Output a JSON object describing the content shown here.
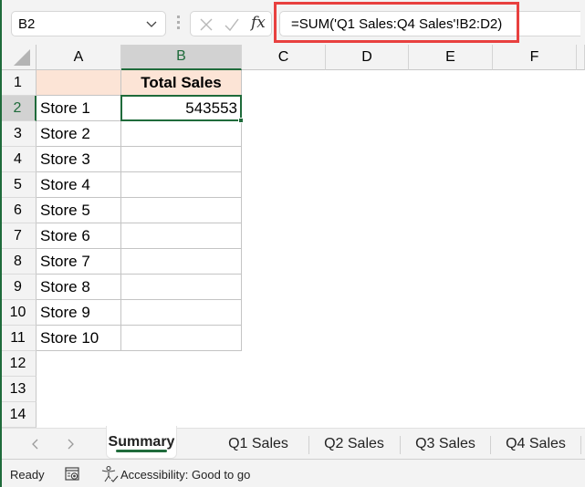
{
  "formula_bar": {
    "name_box": "B2",
    "cancel_icon": "x-icon",
    "enter_icon": "check-icon",
    "fx_label": "fx",
    "formula": "=SUM('Q1 Sales:Q4 Sales'!B2:D2)",
    "highlight_color": "#e8403f"
  },
  "columns": [
    "A",
    "B",
    "C",
    "D",
    "E",
    "F"
  ],
  "selected_column": "B",
  "rows": [
    "1",
    "2",
    "3",
    "4",
    "5",
    "6",
    "7",
    "8",
    "9",
    "10",
    "11",
    "12",
    "13",
    "14"
  ],
  "selected_row": "2",
  "cells": {
    "A": [
      "",
      "Store 1",
      "Store 2",
      "Store 3",
      "Store 4",
      "Store 5",
      "Store 6",
      "Store 7",
      "Store 8",
      "Store 9",
      "Store 10"
    ],
    "B": [
      "Total Sales",
      "543553",
      "",
      "",
      "",
      "",
      "",
      "",
      "",
      "",
      ""
    ]
  },
  "header_fill_color": "#fce4d6",
  "accent_color": "#1f6b3b",
  "sheet_tabs": {
    "prev_icon": "chevron-left-icon",
    "next_icon": "chevron-right-icon",
    "tabs": [
      {
        "label": "Summary",
        "active": true
      },
      {
        "label": "Q1 Sales",
        "active": false
      },
      {
        "label": "Q2 Sales",
        "active": false
      },
      {
        "label": "Q3 Sales",
        "active": false
      },
      {
        "label": "Q4 Sales",
        "active": false
      }
    ]
  },
  "status_bar": {
    "mode": "Ready",
    "accessibility": "Accessibility: Good to go"
  }
}
